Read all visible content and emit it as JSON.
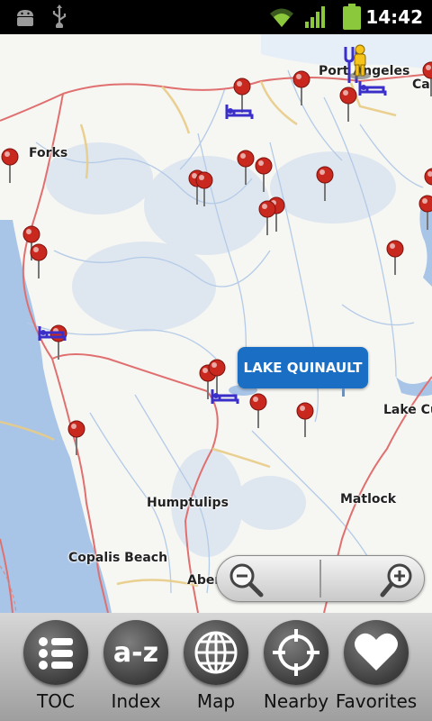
{
  "status_bar": {
    "time": "14:42",
    "icons": [
      "android-debug-icon",
      "usb-icon",
      "wifi-icon",
      "signal-icon",
      "battery-icon"
    ]
  },
  "map": {
    "places": {
      "port_angeles": "Port Angeles",
      "forks": "Forks",
      "lake_cushman": "Lake Cu",
      "humptulips": "Humptulips",
      "matlock": "Matlock",
      "copalis_beach": "Copalis Beach",
      "aberdeen": "Aber",
      "carlsborg": "Car"
    },
    "callout": "LAKE QUINAULT",
    "colors": {
      "land": "#f6f6f2",
      "water": "#a8c4e6",
      "river": "#b4cbe8",
      "highway": "#e07070",
      "road": "#e8cc86",
      "pin": "#c8281e",
      "callout": "#1a6ec4"
    }
  },
  "zoom": {
    "zoom_out": "zoom-out-icon",
    "zoom_in": "zoom-in-icon"
  },
  "toolbar": {
    "items": [
      {
        "label": "TOC",
        "icon": "list-icon"
      },
      {
        "label": "Index",
        "icon": "a-z-icon"
      },
      {
        "label": "Map",
        "icon": "globe-icon"
      },
      {
        "label": "Nearby",
        "icon": "crosshair-icon"
      },
      {
        "label": "Favorites",
        "icon": "heart-icon"
      }
    ],
    "index_glyph": "a-z"
  }
}
